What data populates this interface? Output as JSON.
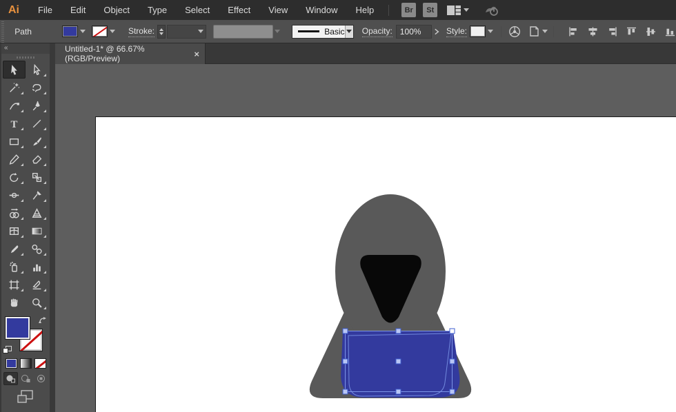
{
  "app": {
    "logo_text": "Ai",
    "logo_color": "#e8913e"
  },
  "menubar": {
    "items": [
      "File",
      "Edit",
      "Object",
      "Type",
      "Select",
      "Effect",
      "View",
      "Window",
      "Help"
    ],
    "bridge_button": "Br",
    "stock_button": "St"
  },
  "controlbar": {
    "selection_type": "Path",
    "stroke_label": "Stroke:",
    "stroke_style_value": "Basic",
    "opacity_label": "Opacity:",
    "opacity_value": "100%",
    "style_label": "Style:"
  },
  "document_tab": {
    "title": "Untitled-1* @ 66.67% (RGB/Preview)",
    "close_glyph": "×"
  },
  "toolbar": {
    "collapse_glyph": "«",
    "type_tool_glyph": "T",
    "tool_names": [
      "selection",
      "direct-selection",
      "magic-wand",
      "lasso",
      "curvature",
      "pen",
      "type",
      "line-segment",
      "rectangle",
      "paintbrush",
      "pencil",
      "eraser",
      "rotate",
      "scale",
      "width",
      "puppet-warp",
      "shape-builder",
      "perspective-grid",
      "mesh",
      "gradient",
      "eyedropper",
      "blend",
      "symbol-sprayer",
      "column-graph",
      "artboard",
      "slice",
      "hand",
      "zoom"
    ],
    "active_tool": "selection",
    "fill_color": "#333a9e",
    "stroke_value": "none",
    "swatch_modes": [
      "color",
      "gradient",
      "none"
    ],
    "drawing_mode": "draw-normal"
  },
  "artwork": {
    "hood_color": "#595959",
    "face_color": "#080808",
    "laptop_color": "#333a9e",
    "selection_accent": "#7d95e8",
    "artboard_color": "#ffffff",
    "pasteboard_color": "#5e5e5e"
  }
}
